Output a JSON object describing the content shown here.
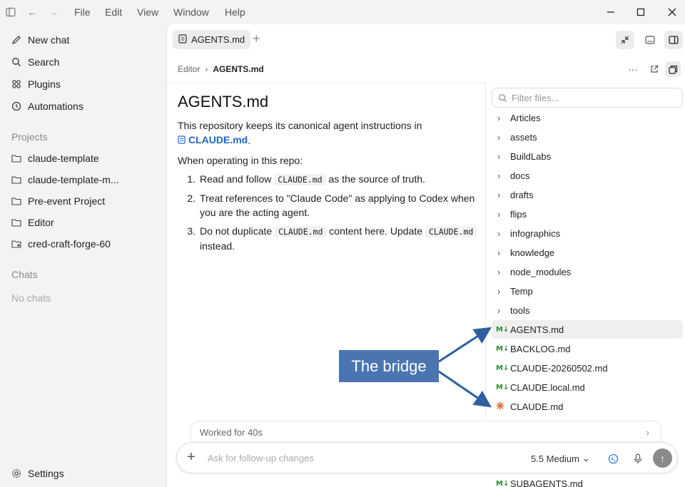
{
  "menu": [
    "File",
    "Edit",
    "View",
    "Window",
    "Help"
  ],
  "sidebar": {
    "actions": [
      {
        "label": "New chat",
        "icon": "pencil-icon"
      },
      {
        "label": "Search",
        "icon": "search-icon"
      },
      {
        "label": "Plugins",
        "icon": "plugins-icon"
      },
      {
        "label": "Automations",
        "icon": "clock-icon"
      }
    ],
    "projects_heading": "Projects",
    "projects": [
      "claude-template",
      "claude-template-m...",
      "Pre-event Project",
      "Editor",
      "cred-craft-forge-60"
    ],
    "chats_heading": "Chats",
    "chats_empty": "No chats",
    "settings_label": "Settings"
  },
  "tab": {
    "label": "AGENTS.md"
  },
  "breadcrumb": {
    "root": "Editor",
    "current": "AGENTS.md"
  },
  "doc": {
    "title": "AGENTS.md",
    "intro": "This repository keeps its canonical agent instructions in",
    "intro_link": "CLAUDE.md",
    "operating": "When operating in this repo:",
    "items": [
      {
        "num": "1.",
        "before": "Read and follow",
        "code": "CLAUDE.md",
        "after": "as the source of truth."
      },
      {
        "num": "2.",
        "text": "Treat references to \"Claude Code\" as applying to Codex when you are the acting agent."
      },
      {
        "num": "3.",
        "before": "Do not duplicate",
        "code": "CLAUDE.md",
        "middle": "content here. Update",
        "code2": "CLAUDE.md",
        "after": "instead."
      }
    ]
  },
  "files": {
    "filter_placeholder": "Filter files...",
    "folders": [
      "Articles",
      "assets",
      "BuildLabs",
      "docs",
      "drafts",
      "flips",
      "infographics",
      "knowledge",
      "node_modules",
      "Temp",
      "tools"
    ],
    "md_files": [
      "AGENTS.md",
      "BACKLOG.md",
      "CLAUDE-20260502.md",
      "CLAUDE.local.md"
    ],
    "claude_file": "CLAUDE.md",
    "bottom_file": "SUBAGENTS.md",
    "md_badge": "M↓",
    "selected": "AGENTS.md"
  },
  "annotation": {
    "label": "The bridge",
    "color": "#4a75b0"
  },
  "composer": {
    "worked_label": "Worked for 40s",
    "placeholder": "Ask for follow-up changes",
    "model_label": "5.5 Medium"
  },
  "colors": {
    "accent": "#2166c5",
    "md_green": "#2e8b3a",
    "claude_orange": "#d9733b"
  }
}
